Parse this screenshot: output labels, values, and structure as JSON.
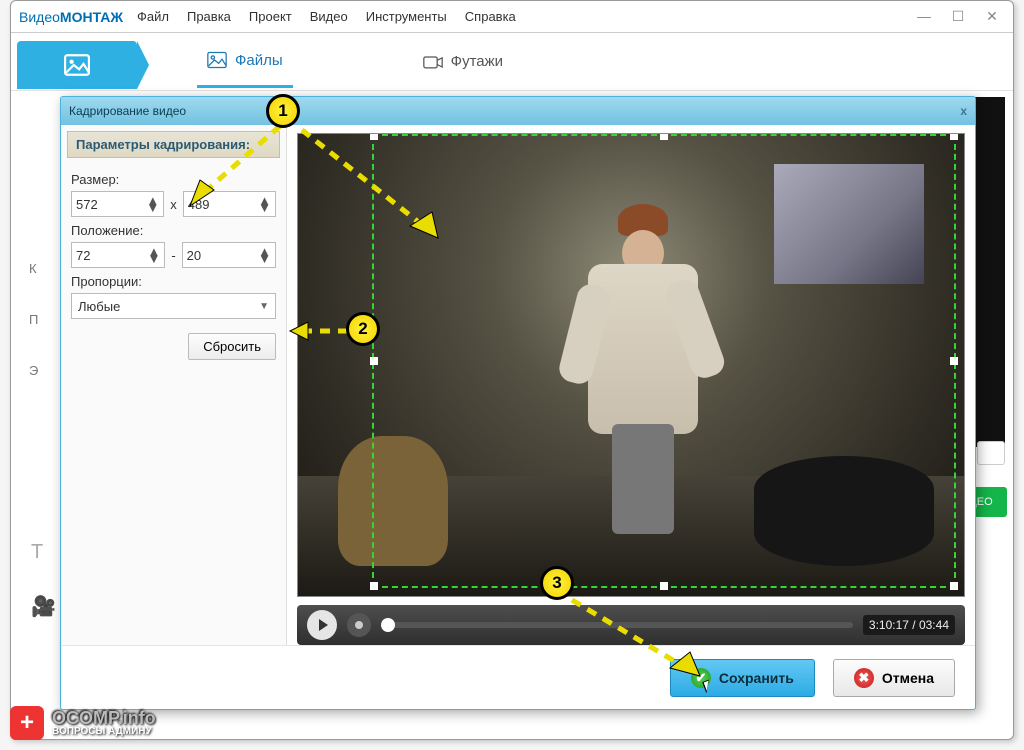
{
  "app": {
    "title_part1": "Видео",
    "title_part2": "МОНТАЖ",
    "menu": [
      "Файл",
      "Правка",
      "Проект",
      "Видео",
      "Инструменты",
      "Справка"
    ]
  },
  "tabs": {
    "files": "Файлы",
    "footages": "Футажи"
  },
  "sidebar": {
    "k": "К",
    "p": "П",
    "e": "Э"
  },
  "bg": {
    "green": "ИДЕО"
  },
  "dialog": {
    "title": "Кадрирование видео",
    "panel_heading": "Параметры кадрирования:",
    "size_label": "Размер:",
    "size_w": "572",
    "size_h": "489",
    "size_sep": "x",
    "pos_label": "Положение:",
    "pos_x": "72",
    "pos_y": "20",
    "pos_sep": "-",
    "aspect_label": "Пропорции:",
    "aspect_value": "Любые",
    "reset": "Сбросить",
    "time": "3:10:17 / 03:44",
    "save": "Сохранить",
    "cancel": "Отмена"
  },
  "callouts": {
    "c1": "1",
    "c2": "2",
    "c3": "3"
  },
  "watermark": {
    "brand1": "OCOMP",
    "brand2": ".info",
    "sub": "ВОПРОСЫ АДМИНУ"
  }
}
